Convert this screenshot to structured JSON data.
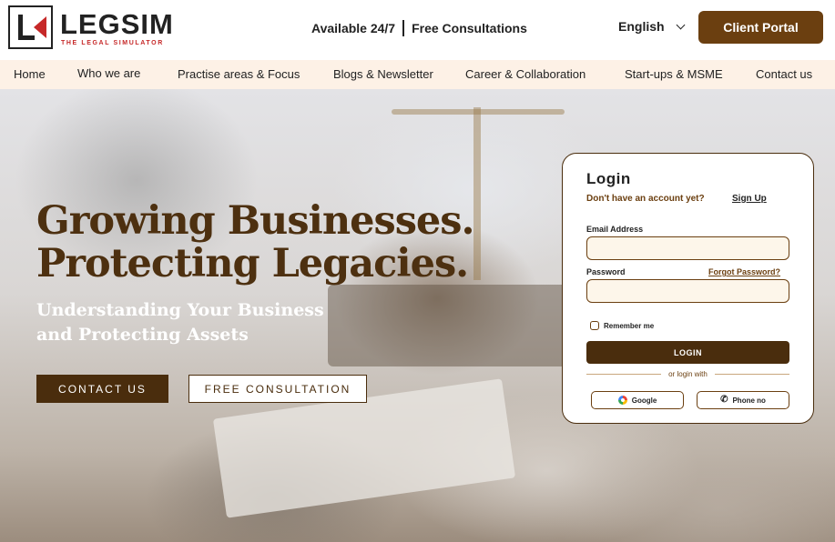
{
  "header": {
    "brand": "LEGSIM",
    "tagline": "THE LEGAL SIMULATOR",
    "availability": "Available 24/7",
    "consultation": "Free Consultations",
    "language": "English",
    "portal_label": "Client Portal"
  },
  "nav": {
    "items": [
      {
        "label": "Home"
      },
      {
        "label": "Who we are"
      },
      {
        "label": "Practise areas & Focus"
      },
      {
        "label": "Blogs & Newsletter"
      },
      {
        "label": "Career &  Collaboration"
      },
      {
        "label": "Start-ups & MSME"
      },
      {
        "label": "Contact us"
      }
    ]
  },
  "hero": {
    "headline_line1": "Growing Businesses.",
    "headline_line2": "Protecting Legacies.",
    "sub_line1": "Understanding Your Business",
    "sub_line2": "and Protecting Assets",
    "contact_label": "CONTACT US",
    "free_label": "FREE CONSULTATION"
  },
  "login": {
    "title": "Login",
    "no_account": "Don't have an account yet?",
    "signup": "Sign Up",
    "email_label": "Email Address",
    "email_value": "",
    "password_label": "Password",
    "password_value": "",
    "forgot": "Forgot Password?",
    "remember": "Remember me",
    "login_button": "LOGIN",
    "or_text": "or login with",
    "google": "Google",
    "phone": "Phone no"
  },
  "colors": {
    "brand_brown": "#6b3f10",
    "dark_brown": "#4a2d0d",
    "nav_bg": "#fdf1e6",
    "logo_red": "#c62828"
  },
  "icons": [
    "logo-mark-icon",
    "chevron-down-icon",
    "google-icon",
    "phone-icon"
  ]
}
